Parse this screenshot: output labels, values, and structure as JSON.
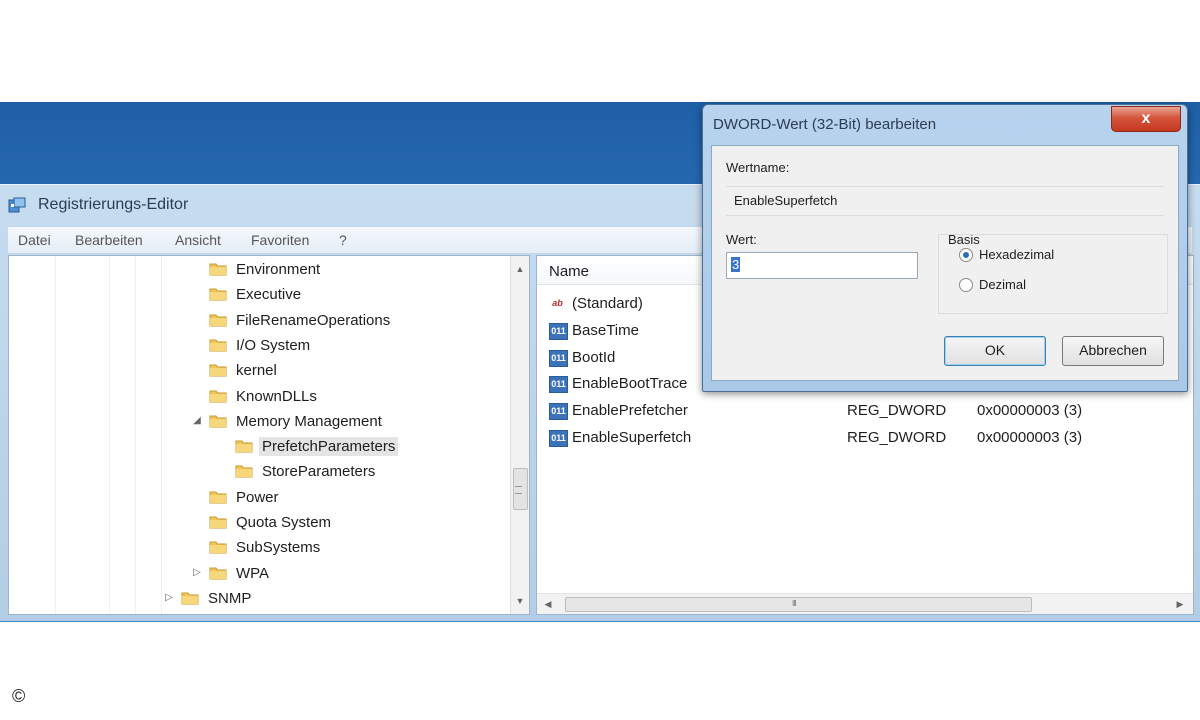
{
  "regedit": {
    "title": "Registrierungs-Editor",
    "menu": [
      "Datei",
      "Bearbeiten",
      "Ansicht",
      "Favoriten",
      "?"
    ],
    "tree": [
      {
        "label": "Environment",
        "expander": ""
      },
      {
        "label": "Executive",
        "expander": ""
      },
      {
        "label": "FileRenameOperations",
        "expander": ""
      },
      {
        "label": "I/O System",
        "expander": ""
      },
      {
        "label": "kernel",
        "expander": ""
      },
      {
        "label": "KnownDLLs",
        "expander": ""
      },
      {
        "label": "Memory Management",
        "expander": "◢"
      },
      {
        "label": "PrefetchParameters",
        "expander": "",
        "selected": true
      },
      {
        "label": "StoreParameters",
        "expander": ""
      },
      {
        "label": "Power",
        "expander": ""
      },
      {
        "label": "Quota System",
        "expander": ""
      },
      {
        "label": "SubSystems",
        "expander": ""
      },
      {
        "label": "WPA",
        "expander": "▷"
      },
      {
        "label": "SNMP",
        "expander": "▷"
      }
    ],
    "values_header": {
      "name": "Name"
    },
    "values": [
      {
        "icon": "string-value-icon",
        "glyph": "ab",
        "name": "(Standard)",
        "type": "",
        "data": ""
      },
      {
        "icon": "binary-value-icon",
        "glyph": "011",
        "name": "BaseTime",
        "type": "",
        "data": ""
      },
      {
        "icon": "binary-value-icon",
        "glyph": "011",
        "name": "BootId",
        "type": "",
        "data": ""
      },
      {
        "icon": "binary-value-icon",
        "glyph": "011",
        "name": "EnableBootTrace",
        "type": "",
        "data": ""
      },
      {
        "icon": "binary-value-icon",
        "glyph": "011",
        "name": "EnablePrefetcher",
        "type": "REG_DWORD",
        "data": "0x00000003 (3)"
      },
      {
        "icon": "binary-value-icon",
        "glyph": "011",
        "name": "EnableSuperfetch",
        "type": "REG_DWORD",
        "data": "0x00000003 (3)"
      }
    ],
    "hscroll_grip": "III"
  },
  "dialog": {
    "title": "DWORD-Wert (32-Bit) bearbeiten",
    "close_glyph": "x",
    "value_name_label": "Wertname:",
    "value_name": "EnableSuperfetch",
    "value_label": "Wert:",
    "value": "3",
    "basis_label": "Basis",
    "radio_hex": "Hexadezimal",
    "radio_dec": "Dezimal",
    "ok": "OK",
    "cancel": "Abbrechen"
  },
  "copyright": "©",
  "colors": {
    "desktop_blue": "#2f74bb",
    "window_frame": "#b3cde6",
    "close_red": "#c4381f",
    "selection_blue": "#3a74c6"
  }
}
